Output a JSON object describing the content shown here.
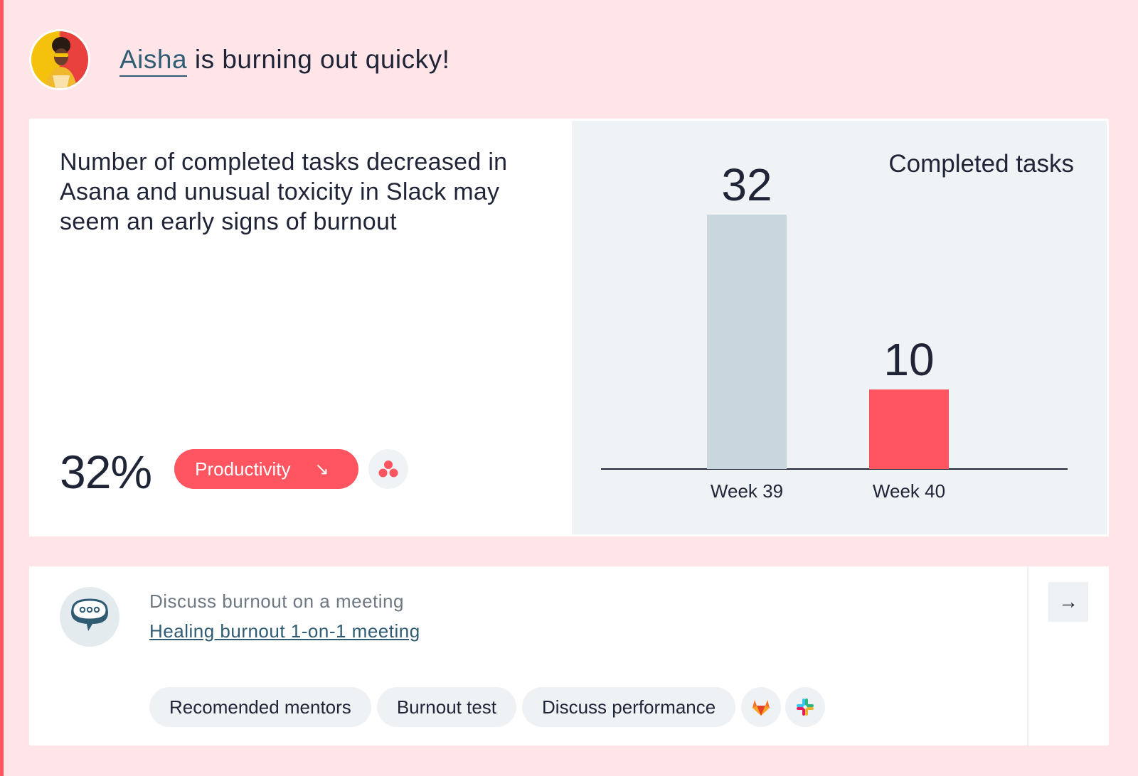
{
  "header": {
    "name": "Aisha",
    "message": " is burning out quicky!"
  },
  "insight": {
    "description": "Number of completed tasks decreased in Asana and unusual toxicity in Slack may seem an early signs of burnout",
    "metric": "32%",
    "tag_label": "Productivity",
    "tag_arrow": "↘",
    "source_icon": "asana-icon"
  },
  "chart_data": {
    "type": "bar",
    "title": "Completed tasks",
    "categories": [
      "Week 39",
      "Week 40"
    ],
    "values": [
      32,
      10
    ],
    "colors": [
      "#c9d6de",
      "#ff5560"
    ],
    "ylim": [
      0,
      32
    ]
  },
  "action": {
    "label": "Discuss burnout on a meeting",
    "link": "Healing burnout 1-on-1 meeting",
    "chips": [
      "Recomended mentors",
      "Burnout test",
      "Discuss performance"
    ],
    "integrations": [
      "gitlab-icon",
      "slack-icon"
    ],
    "next_arrow": "→"
  },
  "colors": {
    "background": "#ffe4e8",
    "accent": "#ff5560",
    "link": "#2f5c73",
    "panel": "#eff3f6"
  }
}
